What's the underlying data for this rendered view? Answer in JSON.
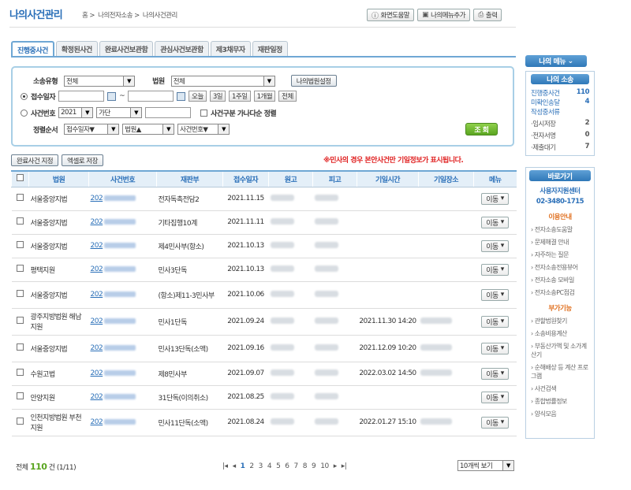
{
  "header": {
    "title": "나의사건관리",
    "breadcrumb": [
      "홈",
      "나의전자소송",
      "나의사건관리"
    ],
    "buttons": [
      {
        "icon": "help-icon",
        "label": "화면도움말"
      },
      {
        "icon": "bookmark-icon",
        "label": "나의메뉴추가"
      },
      {
        "icon": "print-icon",
        "label": "출력"
      }
    ]
  },
  "tabs": [
    "진행중사건",
    "확정된사건",
    "완료사건보관함",
    "관심사건보관함",
    "제3채무자",
    "재판일정"
  ],
  "search": {
    "type_label": "소송유형",
    "type_value": "전체",
    "court_label": "법원",
    "court_value": "전체",
    "my_court_btn": "나의법원설정",
    "date_label": "접수일자",
    "tilde": "~",
    "quick": [
      "오늘",
      "3일",
      "1주일",
      "1개월",
      "전체"
    ],
    "case_label": "사건번호",
    "year": "2021",
    "kind": "가단",
    "sort_check": "사건구분 가나다순 정렬",
    "order_label": "정렬순서",
    "orders": [
      "접수일자▼",
      "법원▲",
      "사건번호▼"
    ],
    "query_btn": "조 회"
  },
  "actions": {
    "complete": "완료사건 지정",
    "excel": "엑셀로 저장"
  },
  "notice": "※민사의 경우 본안사건만 기일정보가 표시됩니다.",
  "table": {
    "headers": [
      "법원",
      "사건번호",
      "재판부",
      "접수일자",
      "원고",
      "피고",
      "기일시간",
      "기일장소",
      "메뉴"
    ],
    "move_label": "이동",
    "rows": [
      {
        "court": "서울중앙지법",
        "case": "202",
        "dept": "전자독촉전담2",
        "date": "2021.11.15",
        "time": ""
      },
      {
        "court": "서울중앙지법",
        "case": "202",
        "dept": "기타집행10계",
        "date": "2021.11.11",
        "time": ""
      },
      {
        "court": "서울중앙지법",
        "case": "202",
        "dept": "제4민사부(항소)",
        "date": "2021.10.13",
        "time": ""
      },
      {
        "court": "평택지원",
        "case": "202",
        "dept": "민사3단독",
        "date": "2021.10.13",
        "time": ""
      },
      {
        "court": "서울중앙지법",
        "case": "202",
        "dept": "(항소)제11-3민사부",
        "date": "2021.10.06",
        "time": ""
      },
      {
        "court": "광주지방법원 해남지원",
        "case": "202",
        "dept": "민사1단독",
        "date": "2021.09.24",
        "time": "2021.11.30 14:20"
      },
      {
        "court": "서울중앙지법",
        "case": "202",
        "dept": "민사13단독(소액)",
        "date": "2021.09.16",
        "time": "2021.12.09 10:20"
      },
      {
        "court": "수원고법",
        "case": "202",
        "dept": "제8민사부",
        "date": "2021.09.07",
        "time": "2022.03.02 14:50"
      },
      {
        "court": "안양지원",
        "case": "202",
        "dept": "31단독(이의취소)",
        "date": "2021.08.25",
        "time": ""
      },
      {
        "court": "인천지방법원 부천지원",
        "case": "202",
        "dept": "민사11단독(소액)",
        "date": "2021.08.24",
        "time": "2022.01.27 15:10"
      }
    ]
  },
  "footer": {
    "total_prefix": "전체",
    "total": "110",
    "total_suffix": "건 (1/11)",
    "pages": [
      "1",
      "2",
      "3",
      "4",
      "5",
      "6",
      "7",
      "8",
      "9",
      "10"
    ],
    "page_size": "10개씩 보기"
  },
  "sidebar": {
    "my_menu": "나의 메뉴",
    "my_case_title": "나의 소송",
    "stats": [
      {
        "label": "진행중사건",
        "value": "110"
      },
      {
        "label": "미확인송달",
        "value": "4"
      },
      {
        "label": "작성중서류",
        "value": ""
      },
      {
        "label": "·임시저장",
        "value": "2"
      },
      {
        "label": "·전자서명",
        "value": "0"
      },
      {
        "label": "·제출대기",
        "value": "7"
      }
    ],
    "shortcut": "바로가기",
    "support_title": "사용자지원센터",
    "phone": "02-3480-1715",
    "guide_title": "이용안내",
    "guide": [
      "전자소송도움말",
      "문제해결 안내",
      "자주하는 질문",
      "전자소송전용뷰어",
      "전자소송 모바일",
      "전자소송PC점검"
    ],
    "extra_title": "부가기능",
    "extra": [
      "관할법원찾기",
      "소송비용계산",
      "부동산가액 및 소가계산기",
      "순해배상 등 계산 프로그램",
      "사건검색",
      "종합법률정보",
      "양식모음"
    ]
  }
}
